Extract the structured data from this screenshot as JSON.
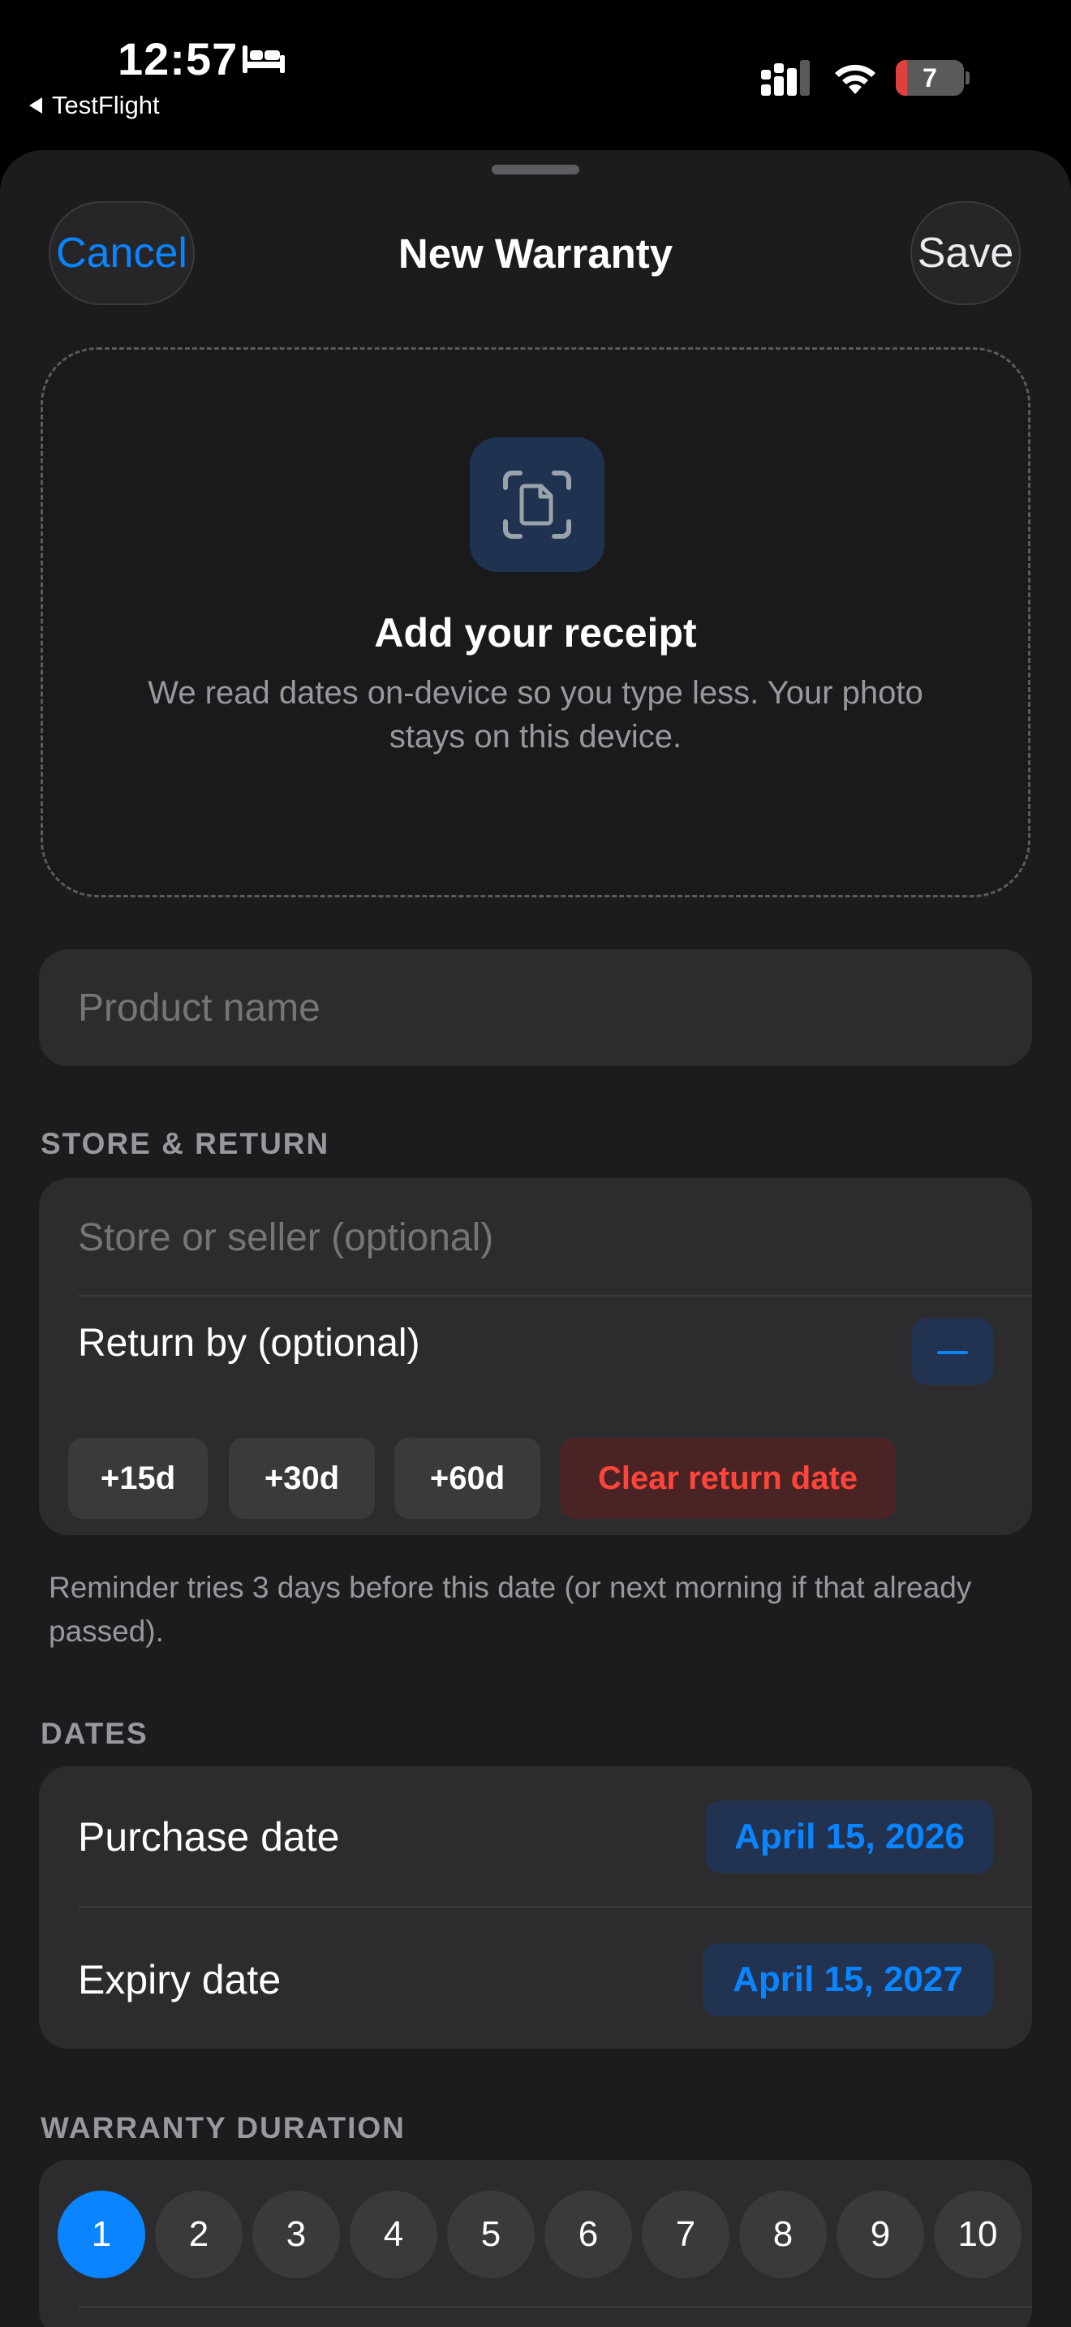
{
  "status_bar": {
    "time": "12:57",
    "back_app": "TestFlight",
    "battery_level": "7",
    "battery_color": "#e0403d"
  },
  "nav": {
    "cancel_label": "Cancel",
    "title": "New Warranty",
    "save_label": "Save"
  },
  "receipt": {
    "icon": "document-scan-icon",
    "title": "Add your receipt",
    "subtitle": "We read dates on-device so you type less. Your photo stays on this device."
  },
  "product": {
    "placeholder": "Product name"
  },
  "store_return": {
    "header": "STORE & RETURN",
    "store_placeholder": "Store or seller (optional)",
    "return_label": "Return by (optional)",
    "chips": [
      "+15d",
      "+30d",
      "+60d"
    ],
    "clear_label": "Clear return date",
    "footnote": "Reminder tries 3 days before this date (or next morning if that already passed)."
  },
  "dates": {
    "header": "DATES",
    "purchase_label": "Purchase date",
    "purchase_value": "April 15, 2026",
    "expiry_label": "Expiry date",
    "expiry_value": "April 15, 2027"
  },
  "duration": {
    "header": "WARRANTY DURATION",
    "options": [
      "1",
      "2",
      "3",
      "4",
      "5",
      "6",
      "7",
      "8",
      "9",
      "10"
    ],
    "selected": "1"
  },
  "colors": {
    "accent": "#0a84ff",
    "destructive": "#ff453a",
    "background": "#1c1c1e",
    "card": "#2c2c2e"
  }
}
